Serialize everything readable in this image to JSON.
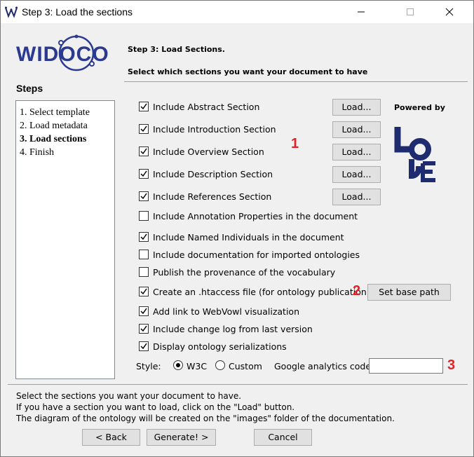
{
  "window": {
    "title": "Step 3: Load the sections"
  },
  "logo_text": "WIDOCO",
  "steps": {
    "title": "Steps",
    "items": [
      {
        "label": "1. Select template",
        "current": false
      },
      {
        "label": "2. Load metadata",
        "current": false
      },
      {
        "label": "3. Load sections",
        "current": true
      },
      {
        "label": "4. Finish",
        "current": false
      }
    ]
  },
  "header": {
    "title": "Step 3: Load Sections.",
    "subtitle": "Select which sections you want your document to have"
  },
  "sections": [
    {
      "label": "Include Abstract Section",
      "checked": true,
      "load": "Load..."
    },
    {
      "label": "Include Introduction Section",
      "checked": true,
      "load": "Load..."
    },
    {
      "label": "Include Overview Section",
      "checked": true,
      "load": "Load..."
    },
    {
      "label": "Include Description Section",
      "checked": true,
      "load": "Load..."
    },
    {
      "label": "Include References Section",
      "checked": true,
      "load": "Load..."
    }
  ],
  "options": [
    {
      "label": "Include Annotation Properties in the document",
      "checked": false
    },
    {
      "label": "Include Named Individuals in the document",
      "checked": true
    },
    {
      "label": "Include documentation for imported ontologies",
      "checked": false
    },
    {
      "label": "Publish the provenance of the vocabulary",
      "checked": false
    },
    {
      "label": "Create an .htaccess file (for ontology publication)",
      "checked": true
    },
    {
      "label": "Add link to WebVowl visualization",
      "checked": true
    },
    {
      "label": "Include change log from last version",
      "checked": true
    },
    {
      "label": "Display ontology serializations",
      "checked": true
    }
  ],
  "set_base_path": "Set base path",
  "powered_by": "Powered by",
  "style": {
    "label": "Style:",
    "options": [
      {
        "label": "W3C",
        "selected": true
      },
      {
        "label": "Custom",
        "selected": false
      }
    ]
  },
  "analytics": {
    "label": "Google analytics code",
    "value": ""
  },
  "annotations": [
    "1",
    "2",
    "3"
  ],
  "info_lines": [
    "Select the sections you want your document to have.",
    "If you have a section you want to load, click on the \"Load\" button.",
    "The diagram of the ontology will be created on the \"images\" folder of the documentation."
  ],
  "nav": {
    "back": "< Back",
    "generate": "Generate! >",
    "cancel": "Cancel"
  },
  "colors": {
    "annotation": "#e0232a",
    "logo_blue": "#2b3a8f",
    "lode_blue": "#1e2b6e"
  }
}
